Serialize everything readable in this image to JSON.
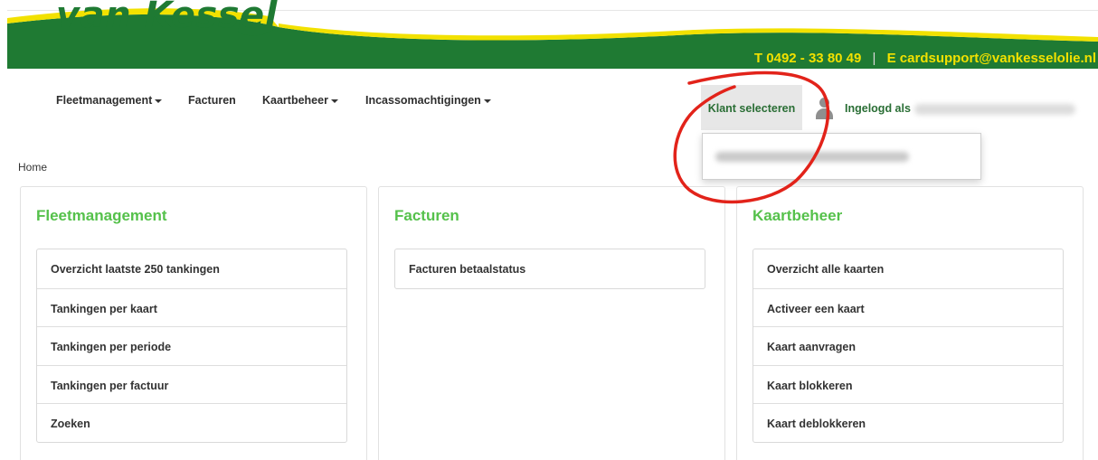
{
  "brand": {
    "logo_text": "van Kessel",
    "phone_prefix": "T",
    "phone": "0492 - 33 80 49",
    "separator": "|",
    "email_prefix": "E",
    "email": "cardsupport@vankesselolie.nl",
    "green": "#1f7a33",
    "yellow": "#f2e100"
  },
  "nav": {
    "items": [
      {
        "label": "Fleetmanagement",
        "has_caret": true
      },
      {
        "label": "Facturen",
        "has_caret": false
      },
      {
        "label": "Kaartbeheer",
        "has_caret": true
      },
      {
        "label": "Incassomachtigingen",
        "has_caret": true
      }
    ],
    "klant_selecteren": "Klant selecteren",
    "ingelogd_als": "Ingelogd als"
  },
  "breadcrumb": "Home",
  "panels": [
    {
      "title": "Fleetmanagement",
      "items": [
        "Overzicht laatste 250 tankingen",
        "Tankingen per kaart",
        "Tankingen per periode",
        "Tankingen per factuur",
        "Zoeken"
      ]
    },
    {
      "title": "Facturen",
      "items": [
        "Facturen betaalstatus"
      ]
    },
    {
      "title": "Kaartbeheer",
      "items": [
        "Overzicht alle kaarten",
        "Activeer een kaart",
        "Kaart aanvragen",
        "Kaart blokkeren",
        "Kaart deblokkeren"
      ]
    }
  ],
  "accent_colors": {
    "panel_title": "#55c14b",
    "annotation": "#e2231a"
  }
}
